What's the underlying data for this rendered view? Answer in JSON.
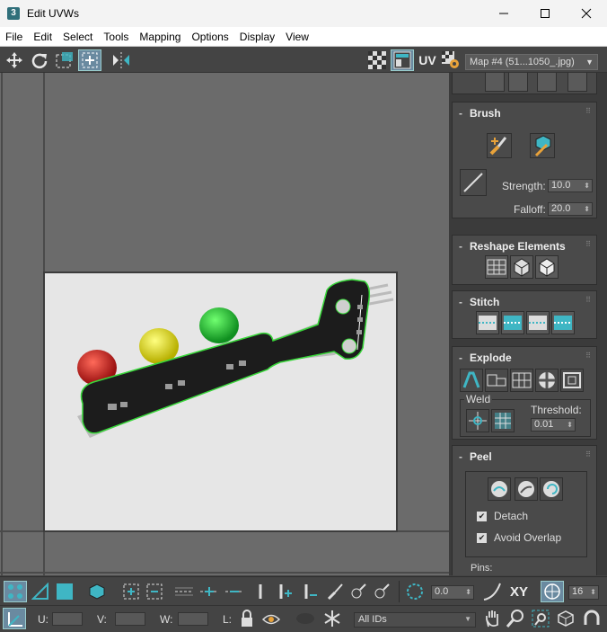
{
  "window": {
    "title": "Edit UVWs",
    "app_icon": "3",
    "minimize": "—",
    "maximize": "☐",
    "close": "✕"
  },
  "menu": [
    "File",
    "Edit",
    "Select",
    "Tools",
    "Mapping",
    "Options",
    "Display",
    "View"
  ],
  "toolbar": {
    "uv_label": "UV",
    "map_select": "Map #4 (51...1050_.jpg)"
  },
  "brush": {
    "title": "Brush",
    "sign": "-",
    "strength_label": "Strength:",
    "strength_value": "10.0",
    "falloff_label": "Falloff:",
    "falloff_value": "20.0"
  },
  "reshape": {
    "title": "Reshape Elements",
    "sign": "-"
  },
  "stitch": {
    "title": "Stitch",
    "sign": "-"
  },
  "explode": {
    "title": "Explode",
    "sign": "-",
    "weld_label": "Weld",
    "threshold_label": "Threshold:",
    "threshold_value": "0.01"
  },
  "peel": {
    "title": "Peel",
    "sign": "-",
    "detach_label": "Detach",
    "avoid_overlap_label": "Avoid Overlap",
    "pins_label": "Pins:",
    "detach_checked": true,
    "avoid_overlap_checked": true
  },
  "bottom": {
    "angle_value": "0.0",
    "xy_label": "XY",
    "grid_value": "16",
    "u_label": "U:",
    "v_label": "V:",
    "w_label": "W:",
    "l_label": "L:",
    "ids_select": "All IDs"
  },
  "colors": {
    "accent": "#3fb6c4",
    "selection": "#39d83a",
    "panel": "#444444"
  }
}
